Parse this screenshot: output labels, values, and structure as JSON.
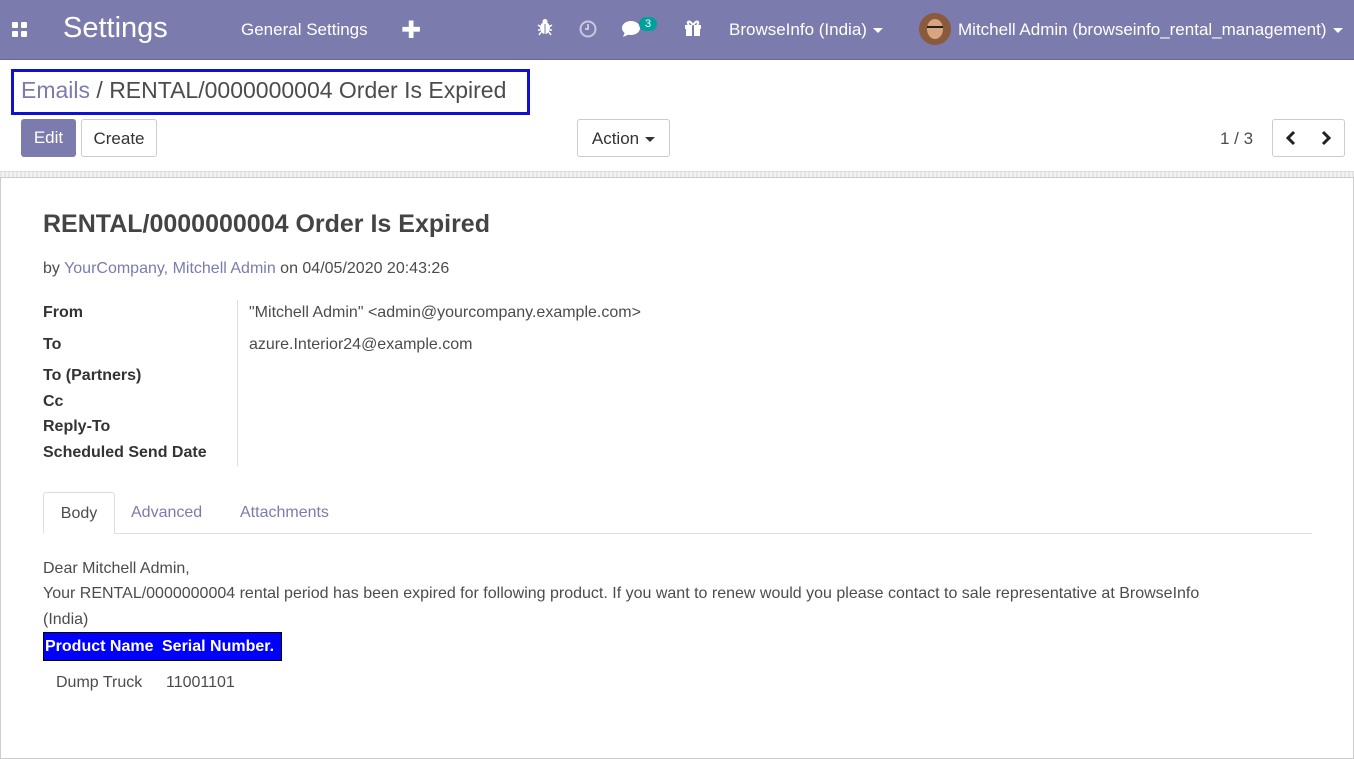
{
  "navbar": {
    "app_title": "Settings",
    "menu_general": "General Settings",
    "add_symbol": "✚",
    "messages_count": "3",
    "company": "BrowseInfo (India)",
    "user": "Mitchell Admin (browseinfo_rental_management)"
  },
  "breadcrumb": {
    "parent": "Emails",
    "separator": " / ",
    "current": "RENTAL/0000000004 Order Is Expired"
  },
  "controls": {
    "edit_label": "Edit",
    "create_label": "Create",
    "action_label": "Action",
    "pager": "1 / 3"
  },
  "email": {
    "title": "RENTAL/0000000004 Order Is Expired",
    "by_prefix": "by ",
    "author": "YourCompany, Mitchell Admin",
    "on_text": " on 04/05/2020 20:43:26",
    "fields": {
      "from_label": "From",
      "from_value": "\"Mitchell Admin\" <admin@yourcompany.example.com>",
      "to_label": "To",
      "to_value": "azure.Interior24@example.com",
      "to_partners_label": "To (Partners)",
      "cc_label": "Cc",
      "reply_to_label": "Reply-To",
      "scheduled_label": "Scheduled Send Date"
    },
    "tabs": [
      "Body",
      "Advanced",
      "Attachments"
    ],
    "body": {
      "greeting": "Dear Mitchell Admin,",
      "line1": "Your RENTAL/0000000004 rental period has been expired for following product. If you want to renew would you please contact to sale representative at BrowseInfo",
      "line2": "(India)",
      "table_headers": [
        "Product Name",
        "Serial Number."
      ],
      "rows": [
        [
          "Dump Truck",
          "11001101"
        ]
      ]
    }
  },
  "colors": {
    "navbar": "#7c7bad",
    "link": "#7c7bad",
    "highlight_box": "#1010d0",
    "table_header": "#0000ff",
    "badge": "#00a09d"
  }
}
